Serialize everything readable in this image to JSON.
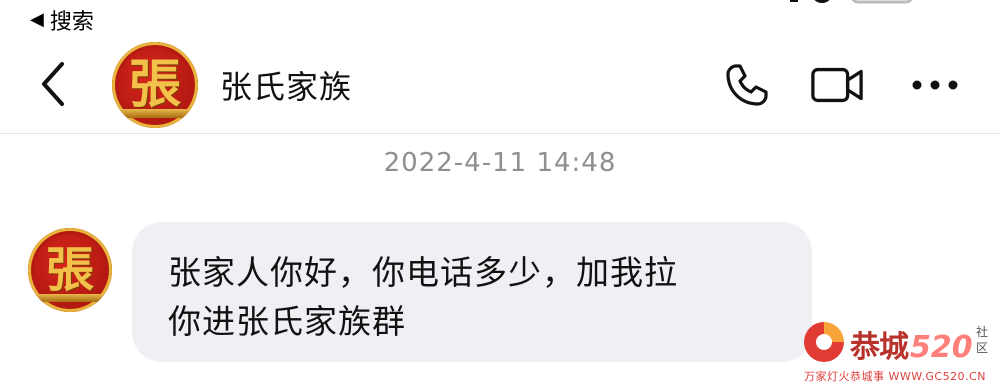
{
  "status_bar": {
    "back_to_app_label": "搜索",
    "back_to_app_icon": "back-triangle-icon"
  },
  "header": {
    "title": "张氏家族",
    "avatar_char": "張",
    "avatar_bg_color": "#c01e16",
    "avatar_char_color": "#f2c14a",
    "buttons": [
      {
        "icon": "phone-icon"
      },
      {
        "icon": "video-camera-icon"
      },
      {
        "icon": "more-icon"
      }
    ]
  },
  "conversation": {
    "timestamp": "2022-4-11 14:48",
    "messages": [
      {
        "sender_avatar_char": "張",
        "lines": [
          "张家人你好，你电话多少，加我拉",
          "你进张氏家族群"
        ],
        "bubble_color": "#efeff4"
      }
    ]
  },
  "watermark": {
    "name": "恭城",
    "number": "520",
    "community": "社区",
    "slogan": "万家灯火恭城事 WWW.GC520.CN"
  }
}
